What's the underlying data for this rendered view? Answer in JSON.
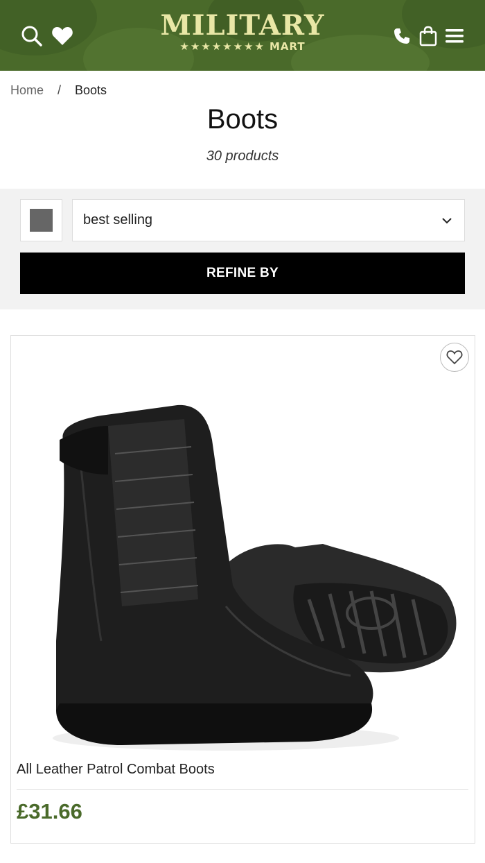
{
  "header": {
    "logo_title": "MILITARY",
    "logo_stars": "★★★★★★★★",
    "logo_sub": "MART",
    "icons": [
      "search-icon",
      "heart-icon",
      "phone-icon",
      "bag-icon",
      "menu-icon"
    ],
    "colors": {
      "background": "#4a6a2a",
      "logo": "#e9e7a6"
    }
  },
  "breadcrumb": {
    "home": "Home",
    "separator": "/",
    "current": "Boots"
  },
  "page": {
    "title": "Boots",
    "product_count": "30 products"
  },
  "filters": {
    "sort_value": "best selling",
    "refine_label": "REFINE BY"
  },
  "products": [
    {
      "name": "All Leather Patrol Combat Boots",
      "price": "£31.66",
      "price_color": "#4a6a2a"
    }
  ]
}
